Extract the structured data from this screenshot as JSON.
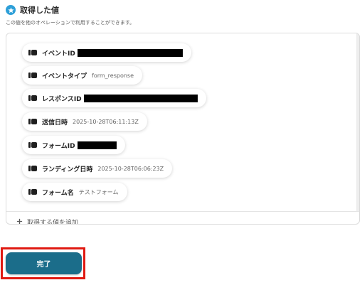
{
  "section": {
    "title": "取得した値",
    "description": "この値を他のオペレーションで利用することができます。"
  },
  "fields": [
    {
      "label": "イベントID",
      "value": "",
      "redacted": true
    },
    {
      "label": "イベントタイプ",
      "value": "form_response",
      "redacted": false
    },
    {
      "label": "レスポンスID",
      "value": "",
      "redacted": true
    },
    {
      "label": "送信日時",
      "value": "2025-10-28T06:11:13Z",
      "redacted": false
    },
    {
      "label": "フォームID",
      "value": "",
      "redacted": true
    },
    {
      "label": "ランディング日時",
      "value": "2025-10-28T06:06:23Z",
      "redacted": false
    },
    {
      "label": "フォーム名",
      "value": "テストフォーム",
      "redacted": false
    }
  ],
  "add_value_label": "取得する値を追加",
  "done_button_label": "完了",
  "colors": {
    "accent": "#1b6d8a",
    "highlight": "#e01a12",
    "badge": "#2d9fd8"
  }
}
